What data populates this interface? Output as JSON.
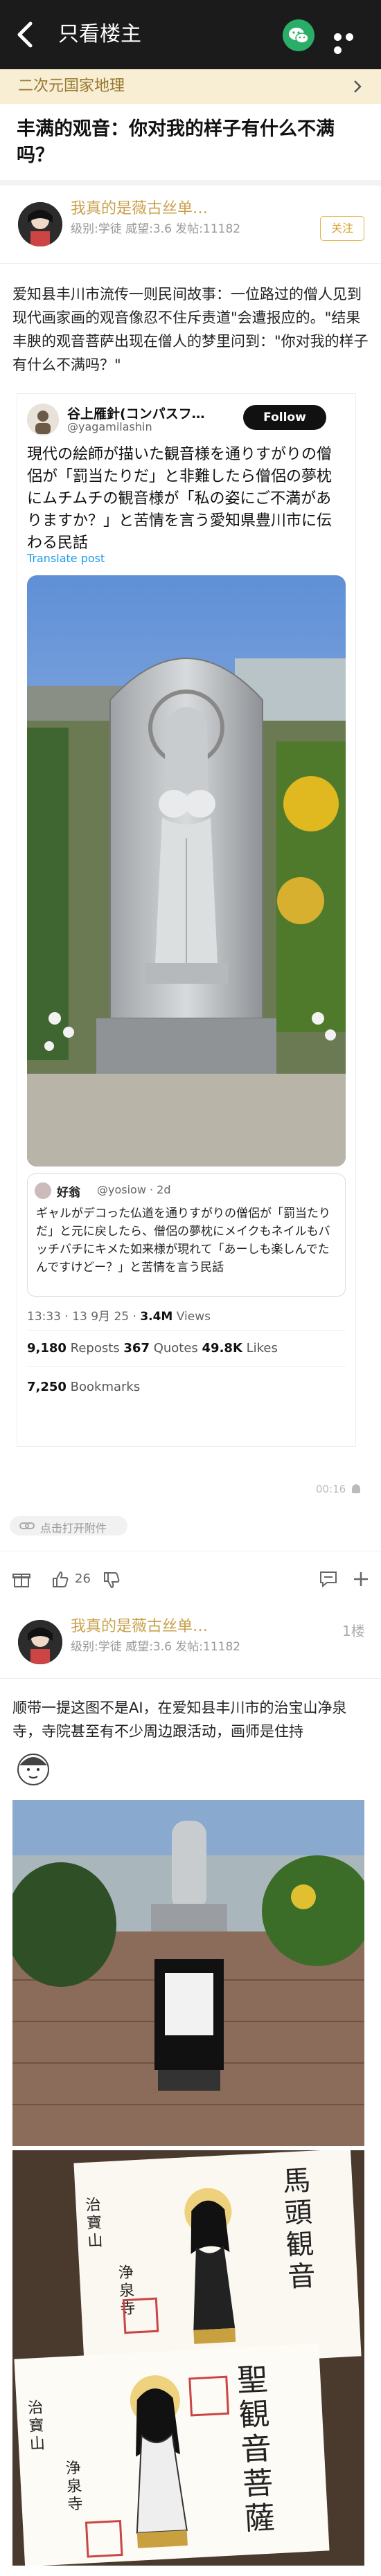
{
  "topbar": {
    "title": "只看楼主"
  },
  "board": {
    "name": "二次元国家地理"
  },
  "thread": {
    "title": "丰满的观音：你对我的样子有什么不满吗？"
  },
  "post1": {
    "author": "我真的是薇古丝单…",
    "meta": "级别:学徒 威望:3.6 发帖:11182",
    "follow": "关注",
    "text": "爱知县丰川市流传一则民间故事：一位路过的僧人见到现代画家画的观音像忍不住斥责道\"会遭报应的。\"结果丰腴的观音菩萨出现在僧人的梦里问到：\"你对我的样子有什么不满吗？\"",
    "tweet": {
      "name": "谷上雁針(コンパスフ…",
      "handle": "@yagamilashin",
      "follow": "Follow",
      "text": "現代の絵師が描いた観音様を通りすがりの僧侶が「罰当たりだ」と非難したら僧侶の夢枕にムチムチの観音様が「私の姿にご不満がありますか？」と苦情を言う愛知県豊川市に伝わる民話",
      "translate": "Translate post",
      "quote": {
        "name": "好翁",
        "handle": "@yosiow · 2d",
        "text": "ギャルがデコった仏道を通りすがりの僧侶が「罰当たりだ」と元に戻したら、僧侶の夢枕にメイクもネイルもバッチバチにキメた如来様が現れて「あーしも楽しんでたんですけどー？」と苦情を言う民話"
      },
      "time": "13:33 · 13 9月 25 · ",
      "views": "3.4M",
      "views_label": " Views",
      "reposts": "9,180",
      "reposts_label": " Reposts   ",
      "quotes": "367",
      "quotes_label": " Quotes   ",
      "likes": "49.8K",
      "likes_label": " Likes",
      "bookmarks": "7,250",
      "bookmarks_label": " Bookmarks"
    },
    "timestamp": "00:16",
    "attach": "点击打开附件",
    "likes": "26"
  },
  "post2": {
    "author": "我真的是薇古丝单…",
    "meta": "级别:学徒 威望:3.6 发帖:11182",
    "floor": "1楼",
    "text": "顺带一提这图不是AI，在爱知县丰川市的治宝山净泉寺，寺院甚至有不少周边跟活动，画师是住持",
    "stamp1": "馬頭観音",
    "stamp2": "聖観音菩薩",
    "stamp_side": "浄泉寺",
    "stamp_mountain": "治寶山"
  }
}
